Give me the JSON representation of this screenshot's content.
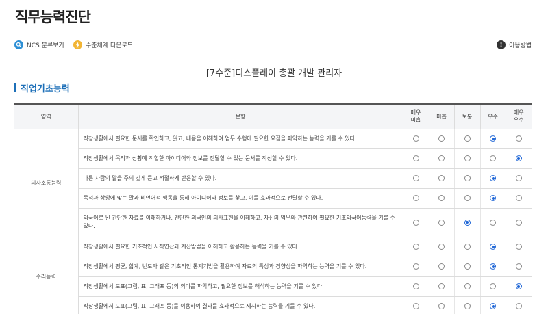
{
  "page": {
    "title": "직무능력진단",
    "job_title": "[7수준]디스플레이 총괄 개발 관리자",
    "section_title": "직업기초능력"
  },
  "toolbar": {
    "ncs_label": "NCS 분류보기",
    "download_label": "수준체계 다운로드",
    "help_label": "이용방법",
    "help_glyph": "!"
  },
  "colors": {
    "accent": "#1d6fb8",
    "ncs_icon": "#2d8fd5",
    "download_icon": "#f2b535",
    "radio_selected": "#1f66d6"
  },
  "icons": {
    "ncs": "search-icon",
    "download": "download-icon",
    "help": "info-icon"
  },
  "table": {
    "headers": {
      "area": "영역",
      "question": "문항",
      "r1": "매우\n미흡",
      "r2": "미흡",
      "r3": "보통",
      "r4": "우수",
      "r5": "매우\n우수"
    },
    "groups": [
      {
        "area": "의사소통능력",
        "rows": [
          {
            "text": "직장생활에서 필요한 문서를 확인하고, 읽고, 내용을 이해하여 업무 수행에 필요한 요점을 파악하는 능력을 기를 수 있다.",
            "selected": 4
          },
          {
            "text": "직장생활에서 목적과 상황에 적합한 아이디어와 정보를 전달할 수 있는 문서를 작성할 수 있다.",
            "selected": 5
          },
          {
            "text": "다른 사람의 말을 주의 깊게 듣고 적절하게 반응할 수 있다.",
            "selected": 4
          },
          {
            "text": "목적과 상황에 맞는 말과 비언어적 행동을 통해 아이디어와 정보를 찾고, 이를 효과적으로 전달할 수 있다.",
            "selected": 4
          },
          {
            "text": "외국어로 된 간단한 자료를 이해하거나, 간단한 외국인의 의사표현을 이해하고, 자신의 업무와 관련하여 필요한 기초외국어능력을 기를 수 있다.",
            "selected": 3
          }
        ]
      },
      {
        "area": "수리능력",
        "rows": [
          {
            "text": "직장생활에서 필요한 기초적인 사칙연산과 계산방법을 이해하고 활용하는 능력을 기를 수 있다.",
            "selected": 4
          },
          {
            "text": "직장생활에서 평균, 합계, 빈도와 같은 기초적인 통계기법을 활용하여 자료의 특성과 경향성을 파악하는 능력을 기를 수 있다.",
            "selected": 4
          },
          {
            "text": "직장생활에서 도표(그림, 표, 그래프 등)의 의미를 파악하고, 필요한 정보를 해석하는 능력을 기를 수 있다.",
            "selected": 5
          },
          {
            "text": "직장생활에서 도표(그림, 표, 그래프 등)를 이용하여 결과를 효과적으로 제시하는 능력을 기를 수 있다.",
            "selected": 4
          }
        ]
      }
    ]
  }
}
